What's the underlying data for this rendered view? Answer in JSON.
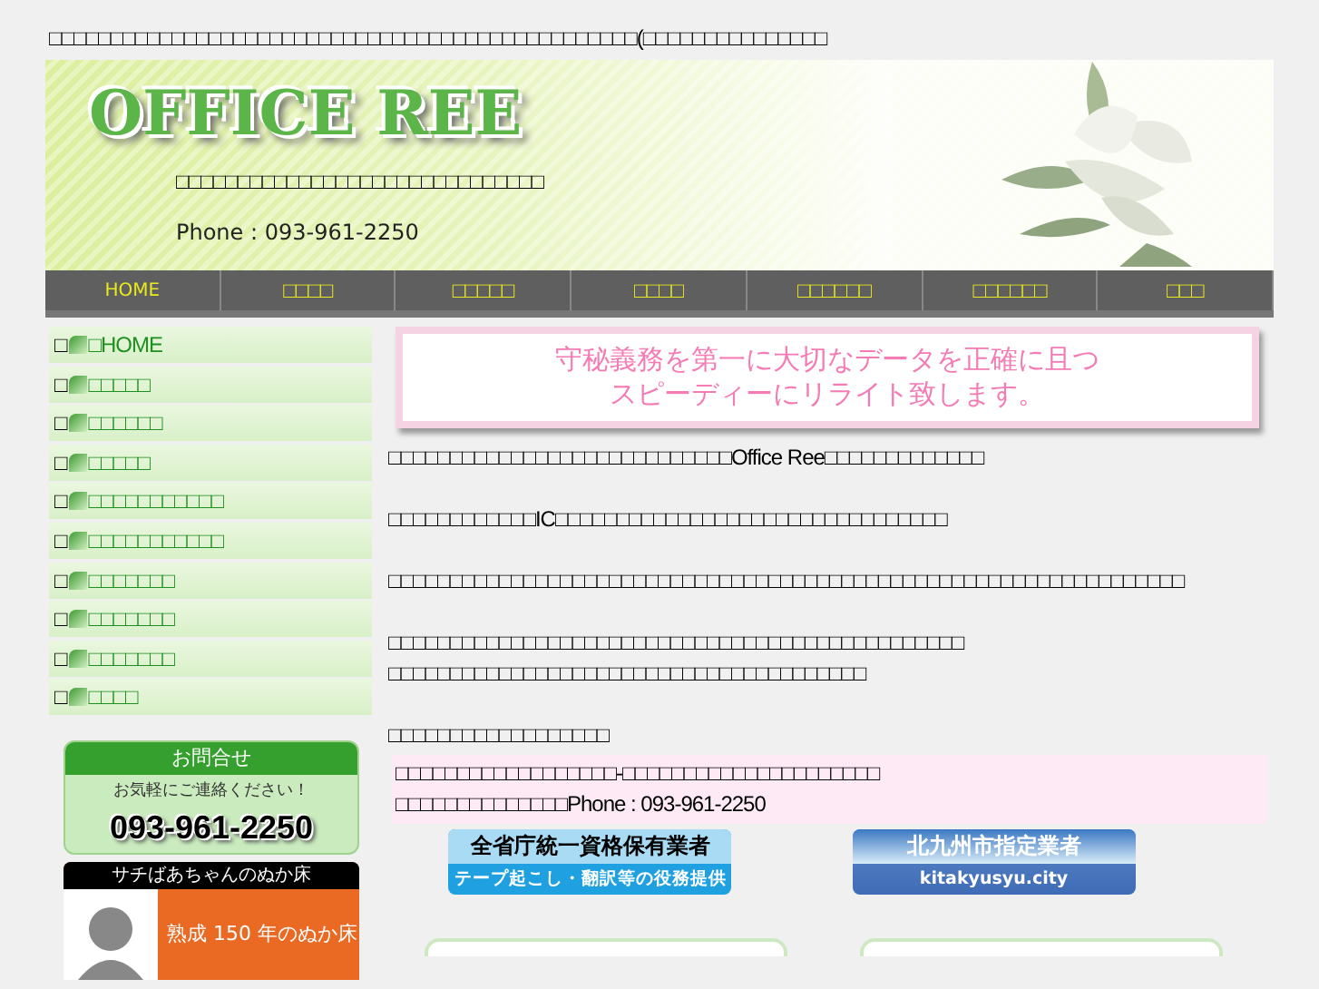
{
  "top_notice": "□□□□□□□□□□□□□□□□□□□□□□□□□□□□□□□□□□□□□□□□□□□□□□□□(□□□□□□□□□□□□□□□",
  "header": {
    "logo": "OFFICE REE",
    "tagline": "□□□□□□□□□□□□□□□□□□□□□□□□□□□□□□",
    "phone": "Phone : 093-961-2250"
  },
  "nav": [
    "HOME",
    "□□□□",
    "□□□□□",
    "□□□□",
    "□□□□□□",
    "□□□□□□",
    "□□□"
  ],
  "sidebar": [
    {
      "prefix": "□",
      "label": "□HOME"
    },
    {
      "prefix": "□",
      "label": "□□□□□"
    },
    {
      "prefix": "□",
      "label": "□□□□□□"
    },
    {
      "prefix": "□",
      "label": "□□□□□"
    },
    {
      "prefix": "□",
      "label": "□□□□□□□□□□□"
    },
    {
      "prefix": "□",
      "label": "□□□□□□□□□□□"
    },
    {
      "prefix": "□",
      "label": "□□□□□□□"
    },
    {
      "prefix": "□",
      "label": "□□□□□□□"
    },
    {
      "prefix": "□",
      "label": "□□□□□□□"
    },
    {
      "prefix": "□",
      "label": "□□□□"
    }
  ],
  "contact_card": {
    "title": "お問合せ",
    "subtitle": "お気軽にご連絡ください！",
    "phone": "093-961-2250"
  },
  "promo_card": {
    "title": "サチばあちゃんのぬか床",
    "text": "熟成 150 年のぬか床"
  },
  "banner_lines": [
    "守秘義務を第一に大切なデータを正確に且つ",
    "スピーディーにリライト致します。"
  ],
  "paragraphs": [
    {
      "lines": [
        "□□□□□□□□□□□□□□□□□□□□□□□□□□□□Office Ree□□□□□□□□□□□□□"
      ]
    },
    {
      "lines": [
        "□□□□□□□□□□□□IC□□□□□□□□□□□□□□□□□□□□□□□□□□□□□□□□"
      ]
    },
    {
      "lines": [
        "□□□□□□□□□□□□□□□□□□□□□□□□□□□□□□□□□□□□□□□□□□□□□□□□□□□□□□□□□□□□□□□□□"
      ]
    },
    {
      "lines": [
        "□□□□□□□□□□□□□□□□□□□□□□□□□□□□□□□□□□□□□□□□□□□□□□□",
        "□□□□□□□□□□□□□□□□□□□□□□□□□□□□□□□□□□□□□□□"
      ]
    },
    {
      "lines": [
        "□□□□□□□□□□□□□□□□□□"
      ]
    }
  ],
  "contact_box": [
    "□□□□□□□□□□□□□□□□□□-□□□□□□□□□□□□□□□□□□□□□",
    "□□□□□□□□□□□□□□Phone : 093-961-2250"
  ],
  "badges": [
    {
      "kind": "sky",
      "top": "全省庁統一資格保有業者",
      "bottom": "テープ起こし・翻訳等の役務提供"
    },
    {
      "kind": "navy",
      "top": "北九州市指定業者",
      "bottom": "kitakyusyu.city"
    }
  ]
}
